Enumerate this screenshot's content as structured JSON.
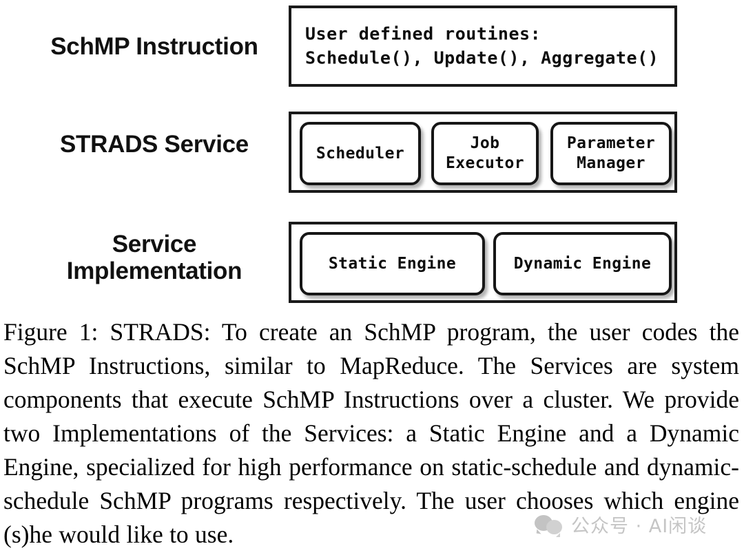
{
  "figure": {
    "rows": [
      {
        "label": "SchMP Instruction",
        "content_text": "User defined routines:\nSchedule(), Update(), Aggregate()"
      },
      {
        "label": "STRADS Service",
        "boxes": [
          {
            "label": "Scheduler"
          },
          {
            "label": "Job\nExecutor"
          },
          {
            "label": "Parameter\nManager"
          }
        ]
      },
      {
        "label": "Service\nImplementation",
        "boxes": [
          {
            "label": "Static Engine"
          },
          {
            "label": "Dynamic Engine"
          }
        ]
      }
    ],
    "caption": "Figure 1: STRADS: To create an SchMP program, the user codes the SchMP Instructions, similar to MapReduce. The Services are system components that execute SchMP Instructions over a cluster. We provide two Implementations of the Services: a Static Engine and a Dynamic Engine, specialized for high performance on static-schedule and dynamic-schedule SchMP programs respectively. The user chooses which engine (s)he would like to use."
  },
  "watermark": {
    "text": "公众号 · AI闲谈",
    "color": "#bcbcbc"
  },
  "colors": {
    "stroke": "#161616",
    "background": "#ffffff",
    "text": "#000000"
  }
}
